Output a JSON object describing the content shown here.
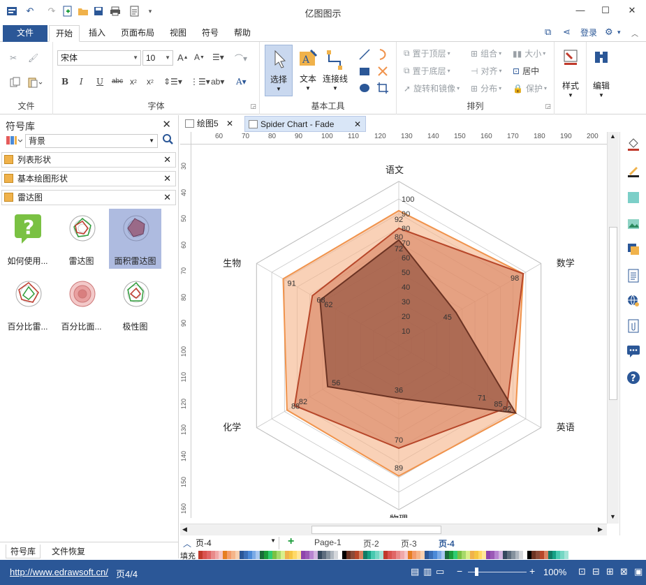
{
  "app": {
    "title": "亿图图示"
  },
  "menu": {
    "tabs": [
      "文件",
      "开始",
      "插入",
      "页面布局",
      "视图",
      "符号",
      "帮助"
    ],
    "login": "登录"
  },
  "ribbon": {
    "file_group": "文件",
    "font_group": "字体",
    "font_name": "宋体",
    "font_size": "10",
    "tools_group": "基本工具",
    "select_label": "选择",
    "text_label": "文本",
    "connector_label": "连接线",
    "arrange_group": "排列",
    "bring_front": "置于顶层",
    "send_back": "置于底层",
    "rotate_mirror": "旋转和镜像",
    "group": "组合",
    "align": "对齐",
    "distribute": "分布",
    "size": "大小",
    "center": "居中",
    "protect": "保护",
    "style": "样式",
    "edit": "编辑"
  },
  "library": {
    "title": "符号库",
    "search_value": "背景",
    "sections": [
      "列表形状",
      "基本绘图形状",
      "雷达图"
    ],
    "shapes": [
      "如何使用...",
      "雷达图",
      "面积雷达图",
      "百分比雷...",
      "百分比面...",
      "极性图"
    ],
    "bottom_tabs": [
      "符号库",
      "文件恢复"
    ]
  },
  "documents": {
    "tabs": [
      "绘图5",
      "Spider Chart - Fade"
    ]
  },
  "rulers": {
    "h_ticks": [
      "60",
      "70",
      "80",
      "90",
      "100",
      "110",
      "120",
      "130",
      "140",
      "150",
      "160",
      "170",
      "180",
      "190",
      "200"
    ],
    "v_ticks": [
      "30",
      "40",
      "50",
      "60",
      "70",
      "80",
      "90",
      "100",
      "110",
      "120",
      "130",
      "140",
      "150",
      "160"
    ]
  },
  "pages": {
    "current": "页-4",
    "tabs": [
      "Page-1",
      "页-2",
      "页-3",
      "页-4"
    ]
  },
  "fill_label": "填充",
  "status": {
    "url": "http://www.edrawsoft.cn/",
    "page": "页4/4",
    "zoom": "100%"
  },
  "chart_data": {
    "type": "radar",
    "axes": [
      "语文",
      "数学",
      "英语",
      "物理",
      "化学",
      "生物"
    ],
    "scale_max": 100,
    "scale_ticks": [
      "10",
      "20",
      "30",
      "40",
      "50",
      "60",
      "70",
      "80",
      "90",
      "100"
    ],
    "series": [
      {
        "values": [
          92,
          98,
          92,
          89,
          88,
          91
        ],
        "color": "#f0934c",
        "fill": "#f5b58a",
        "value_labels": [
          "92",
          "98",
          "92",
          "89",
          "88",
          "91"
        ]
      },
      {
        "values": [
          80,
          98,
          85,
          70,
          82,
          68
        ],
        "color": "#b7472a",
        "fill": "#d98261",
        "value_labels": [
          "80",
          "",
          "85",
          "70",
          "82",
          "68"
        ]
      },
      {
        "values": [
          72,
          45,
          92,
          36,
          56,
          62
        ],
        "color": "#6b3323",
        "fill": "#8a4a38",
        "value_labels": [
          "72",
          "45",
          "",
          "36",
          "56",
          "62"
        ]
      }
    ],
    "extra_value_labels": [
      {
        "axis": "英语",
        "value": "71"
      }
    ]
  }
}
